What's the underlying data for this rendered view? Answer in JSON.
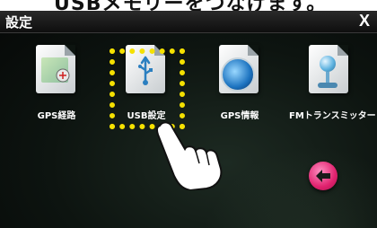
{
  "header": {
    "top_caption": "USBメモリーをつなげます。"
  },
  "window": {
    "title": "設定",
    "close_label": "X"
  },
  "icons": [
    {
      "label": "GPS経路",
      "icon": "gps-route-icon"
    },
    {
      "label": "USB設定",
      "icon": "usb-settings-icon"
    },
    {
      "label": "GPS情報",
      "icon": "gps-info-icon"
    },
    {
      "label": "FMトランスミッター",
      "icon": "fm-transmitter-icon"
    }
  ],
  "overlay": {
    "highlight": "dotted-yellow-box",
    "pointer": "hand-pointer-icon"
  },
  "back_button": {
    "icon": "back-arrow-icon",
    "color": "#e0226e"
  },
  "colors": {
    "highlight": "#f5e100",
    "background": "#0d1410",
    "title": "#ffffff"
  }
}
